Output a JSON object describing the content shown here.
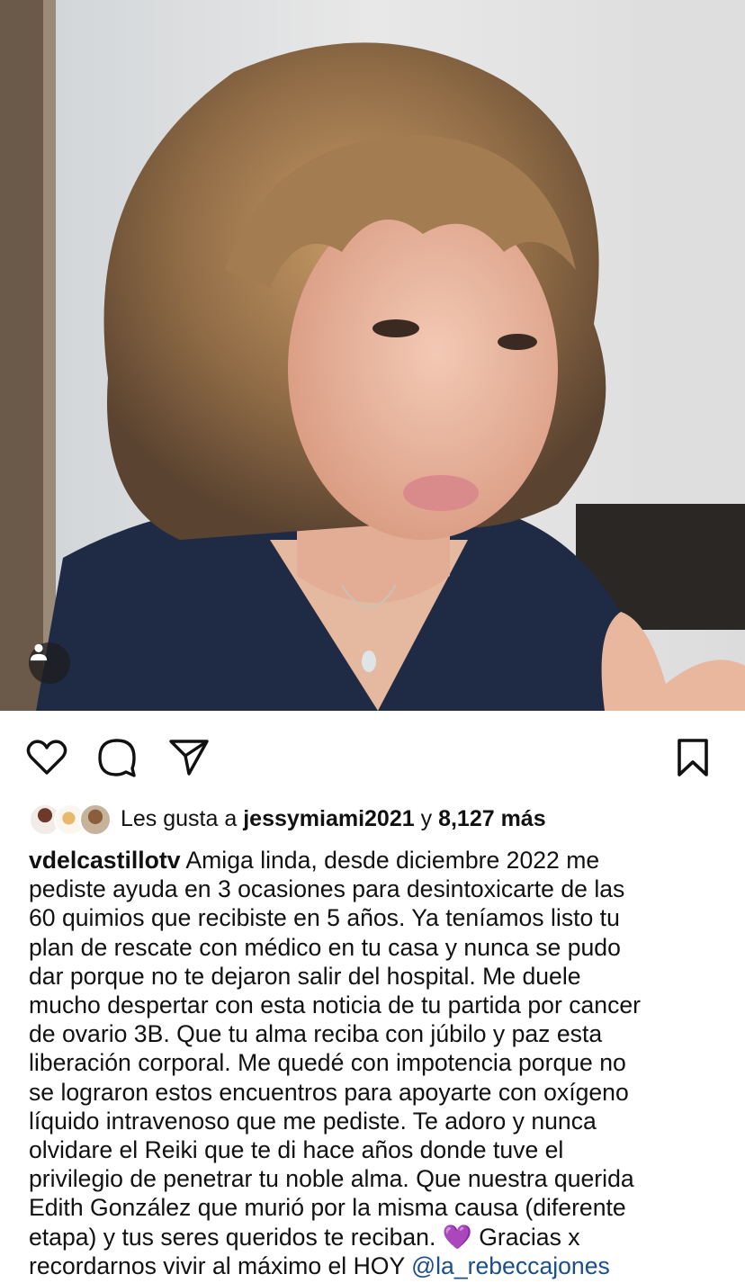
{
  "post": {
    "image_alt": "Retrato de mujer con cabello castaño ondulado y saco azul marino",
    "user_tag_icon": "person-icon"
  },
  "actions": {
    "like_icon": "heart-icon",
    "comment_icon": "comment-bubble-icon",
    "share_icon": "paper-plane-icon",
    "save_icon": "bookmark-icon"
  },
  "likes": {
    "prefix": "Les gusta a ",
    "user": "jessymiami2021",
    "middle": " y ",
    "count": "8,127 más"
  },
  "caption": {
    "author": "vdelcastillotv",
    "lines": [
      " Amiga linda, desde diciembre 2022 me",
      "pediste ayuda en 3 ocasiones para desintoxicarte de las",
      "60 quimios que recibiste en 5 años. Ya teníamos listo tu",
      "plan de rescate con médico en tu casa y nunca se pudo",
      "dar porque no te dejaron salir del hospital. Me duele",
      "mucho despertar con esta noticia de tu partida por cancer",
      "de ovario 3B. Que tu alma reciba con júbilo y paz esta",
      "liberación corporal. Me quedé con impotencia porque no",
      "se lograron estos encuentros para apoyarte con oxígeno",
      "líquido intravenoso que me pediste. Te adoro y nunca",
      "olvidare el Reiki que te di hace años donde tuve el",
      "privilegio de penetrar tu noble alma. Que nuestra querida",
      "Edith González que murió por la misma causa (diferente",
      "etapa) y tus seres queridos te reciban. "
    ],
    "emoji": "💜",
    "after_emoji": "  Gracias x",
    "last_line": "recordarnos vivir al máximo el HOY ",
    "mention": "@la_rebeccajones"
  },
  "colors": {
    "mention": "#1b4f8a",
    "text": "#111111",
    "background": "#ffffff"
  }
}
